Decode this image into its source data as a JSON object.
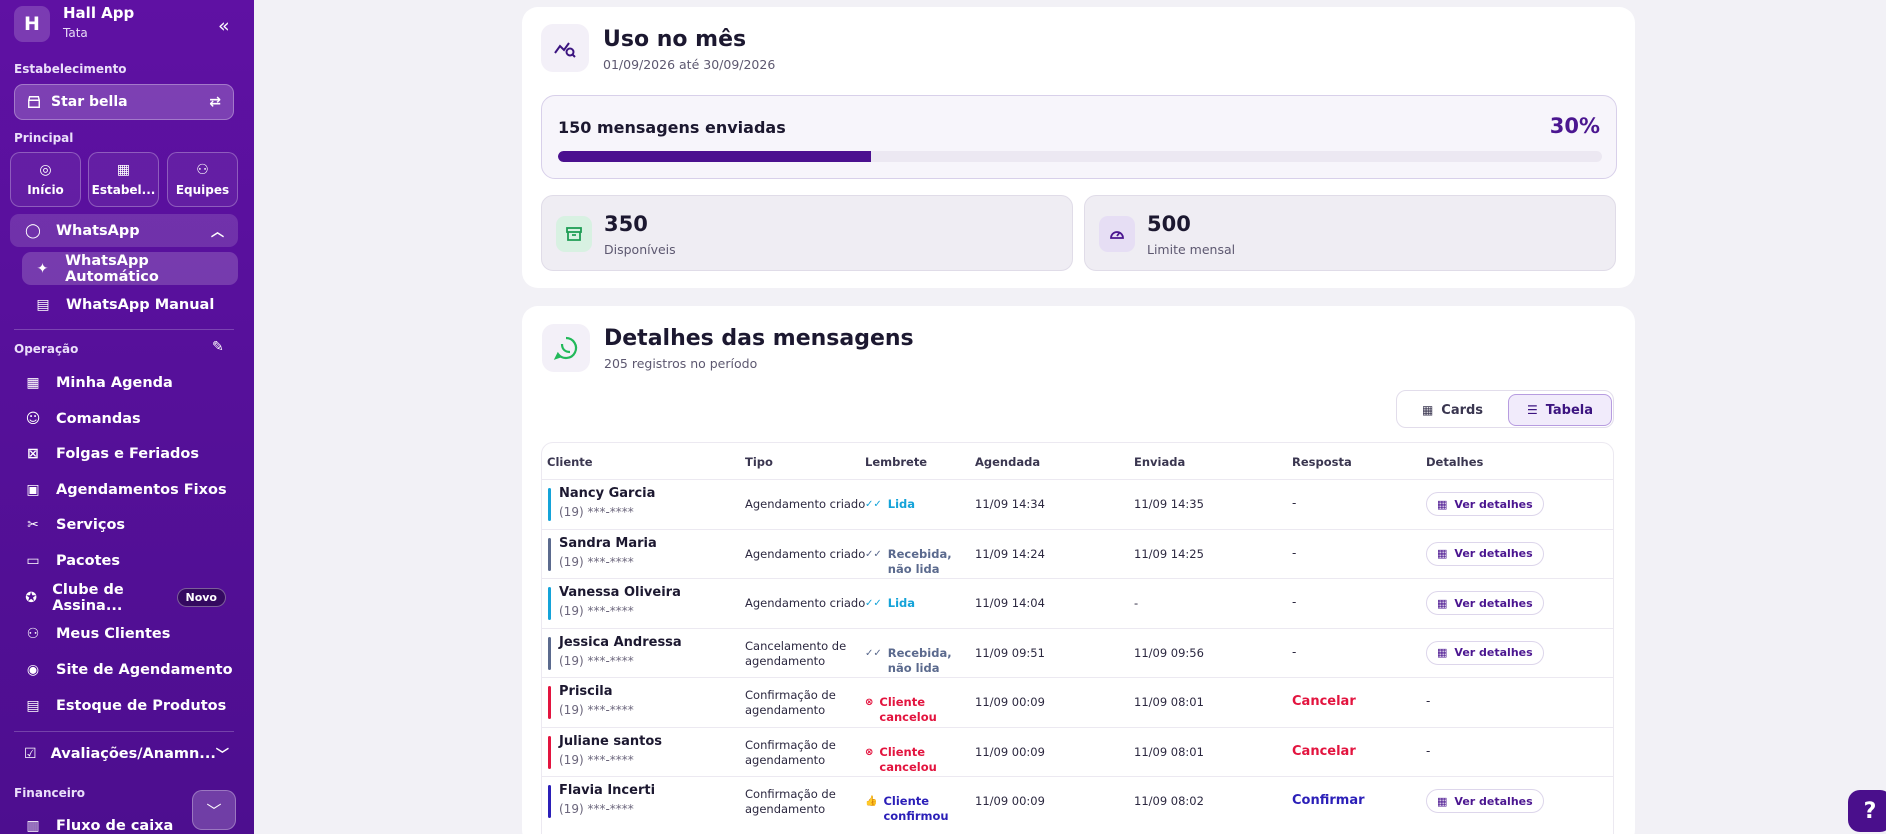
{
  "app": {
    "name": "Hall App",
    "user": "Tata",
    "logo_letter": "H"
  },
  "sidebar": {
    "estabelecimento_label": "Estabelecimento",
    "estabelecimento_value": "Star bella",
    "principal_label": "Principal",
    "quick": [
      {
        "label": "Início",
        "icon": "home-icon"
      },
      {
        "label": "Estabel...",
        "icon": "store-icon"
      },
      {
        "label": "Equipes",
        "icon": "team-icon"
      }
    ],
    "whatsapp": "WhatsApp",
    "whatsapp_auto": "WhatsApp Automático",
    "whatsapp_manual": "WhatsApp Manual",
    "operacao_label": "Operação",
    "items": [
      {
        "label": "Minha Agenda",
        "icon": "calendar-icon"
      },
      {
        "label": "Comandas",
        "icon": "receipt-icon"
      },
      {
        "label": "Folgas e Feriados",
        "icon": "calendar-x-icon"
      },
      {
        "label": "Agendamentos Fixos",
        "icon": "calendar-repeat-icon"
      },
      {
        "label": "Serviços",
        "icon": "tools-icon"
      },
      {
        "label": "Pacotes",
        "icon": "package-icon"
      },
      {
        "label": "Clube de Assina...",
        "icon": "award-icon",
        "badge": "Novo"
      },
      {
        "label": "Meus Clientes",
        "icon": "users-icon"
      },
      {
        "label": "Site de Agendamento",
        "icon": "globe-icon"
      },
      {
        "label": "Estoque de Produtos",
        "icon": "archive-icon"
      }
    ],
    "avaliacoes": "Avaliações/Anamn...",
    "financeiro_label": "Financeiro",
    "fluxo": "Fluxo de caixa"
  },
  "usage": {
    "title": "Uso no mês",
    "period": "01/09/2026 até 30/09/2026",
    "sent_label": "150 mensagens enviadas",
    "percent_label": "30%",
    "percent": 30,
    "available_value": "350",
    "available_label": "Disponíveis",
    "limit_value": "500",
    "limit_label": "Limite mensal"
  },
  "details": {
    "title": "Detalhes das mensagens",
    "subtitle": "205 registros no período",
    "view_cards": "Cards",
    "view_table": "Tabela",
    "columns": [
      "Cliente",
      "Tipo",
      "Lembrete",
      "Agendada",
      "Enviada",
      "Resposta",
      "Detalhes"
    ],
    "detail_button": "Ver detalhes",
    "rows": [
      {
        "name": "Nancy Garcia",
        "phone": "(19) ***-****",
        "tipo": "Agendamento criado",
        "lembrete": "Lida",
        "status": "read",
        "agendada": "11/09 14:34",
        "enviada": "11/09 14:35",
        "resposta": "-",
        "details": true
      },
      {
        "name": "Sandra Maria",
        "phone": "(19) ***-****",
        "tipo": "Agendamento criado",
        "lembrete": "Recebida, não lida",
        "status": "received",
        "agendada": "11/09 14:24",
        "enviada": "11/09 14:25",
        "resposta": "-",
        "details": true
      },
      {
        "name": "Vanessa Oliveira",
        "phone": "(19) ***-****",
        "tipo": "Agendamento criado",
        "lembrete": "Lida",
        "status": "read",
        "agendada": "11/09 14:04",
        "enviada": "-",
        "resposta": "-",
        "details": true
      },
      {
        "name": "Jessica Andressa",
        "phone": "(19) ***-****",
        "tipo": "Cancelamento de agendamento",
        "lembrete": "Recebida, não lida",
        "status": "received",
        "agendada": "11/09 09:51",
        "enviada": "11/09 09:56",
        "resposta": "-",
        "details": true
      },
      {
        "name": "Priscila",
        "phone": "(19) ***-****",
        "tipo": "Confirmação de agendamento",
        "lembrete": "Cliente cancelou",
        "status": "cancelled",
        "agendada": "11/09 00:09",
        "enviada": "11/09 08:01",
        "resposta": "Cancelar",
        "details": false
      },
      {
        "name": "Juliane santos",
        "phone": "(19) ***-****",
        "tipo": "Confirmação de agendamento",
        "lembrete": "Cliente cancelou",
        "status": "cancelled",
        "agendada": "11/09 00:09",
        "enviada": "11/09 08:01",
        "resposta": "Cancelar",
        "details": false
      },
      {
        "name": "Flavia Incerti",
        "phone": "(19) ***-****",
        "tipo": "Confirmação de agendamento",
        "lembrete": "Cliente confirmou",
        "status": "confirmed",
        "agendada": "11/09 00:09",
        "enviada": "11/09 08:02",
        "resposta": "Confirmar",
        "details": true
      }
    ],
    "dash": "-"
  },
  "colors": {
    "read": "#14a3d9",
    "received": "#5b6a8e",
    "cancelled": "#e3143f",
    "confirmed": "#2b1fb8",
    "brand": "#4b108f"
  },
  "help_label": "?"
}
